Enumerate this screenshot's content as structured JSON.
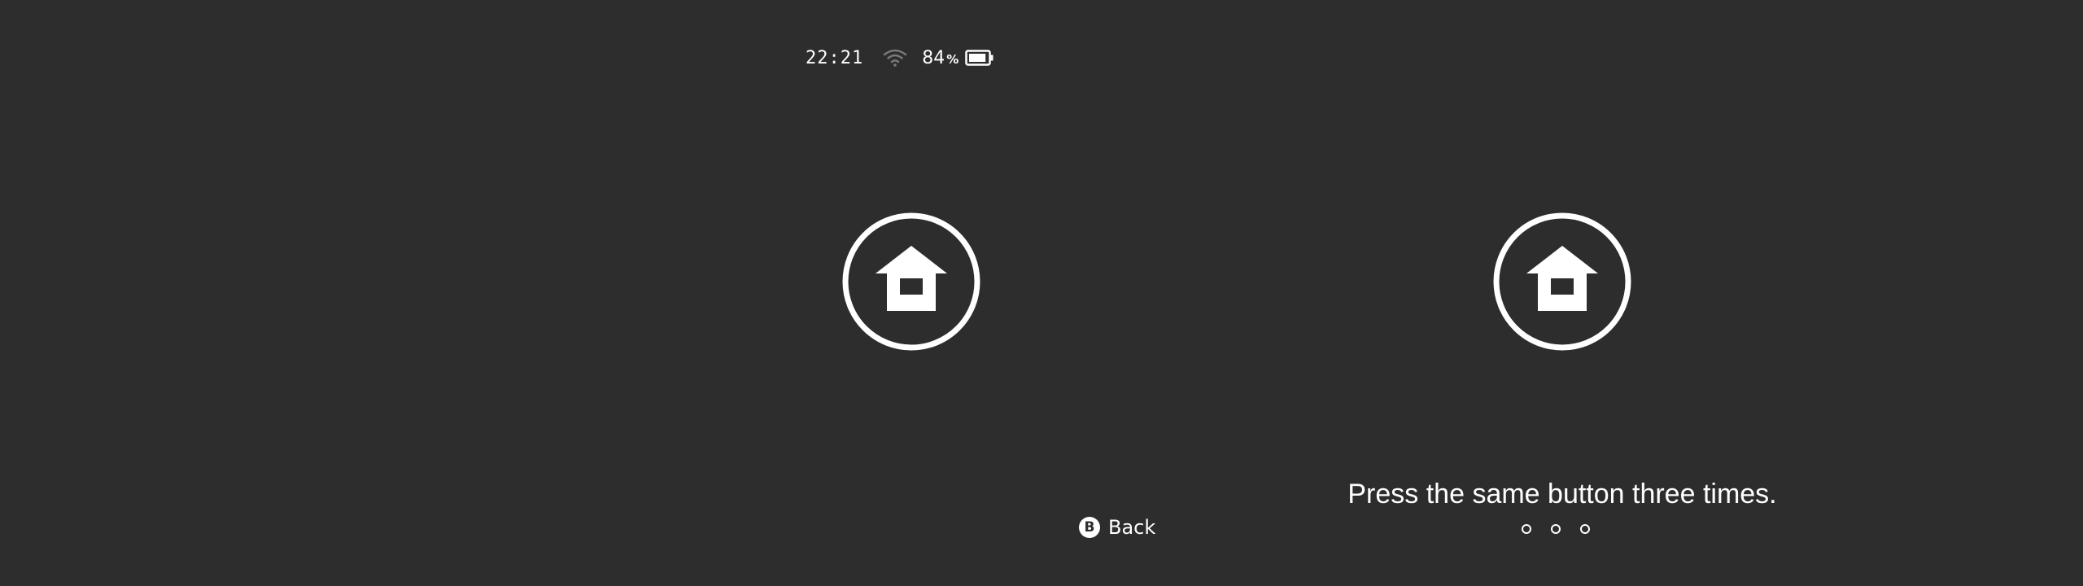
{
  "status_bar": {
    "time": "22:21",
    "wifi_icon": "wifi-icon",
    "battery_percent": "84",
    "battery_percent_sign": "%",
    "battery_level": 0.84,
    "battery_icon": "battery-icon"
  },
  "home_buttons": [
    {
      "icon": "home-icon"
    },
    {
      "icon": "home-icon"
    }
  ],
  "back_hint": {
    "glyph": "B",
    "label": "Back"
  },
  "instruction": {
    "text": "Press the same button three times.",
    "press_count": 3,
    "presses_done": 0
  },
  "colors": {
    "background": "#2d2d2d",
    "foreground": "#ffffff",
    "wifi_dim": "#7a7a7a"
  }
}
